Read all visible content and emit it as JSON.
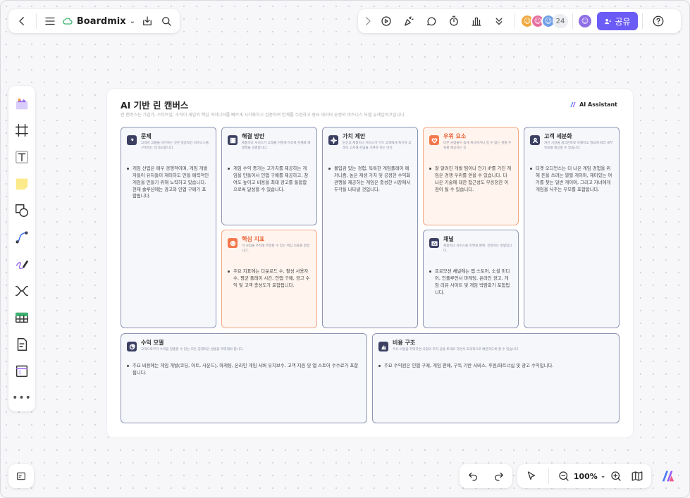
{
  "topbar": {
    "app_name": "Boardmix",
    "share_label": "공유",
    "collaborator_count": "24"
  },
  "bottombar": {
    "zoom": "100%"
  },
  "canvas": {
    "title": "AI 기반 린 캔버스",
    "subtitle": "린 캔버스는 기업가, 스타트업, 조직이 게임의 핵심 아이디어를 빠르게 시각화하고 검증하여 한계를 수정하고 중요 데이터 공생의 비즈니스 모델 유레임워크입니다.",
    "ai_assistant_label": "AI Assistant",
    "cards": {
      "problem": {
        "title": "문제",
        "desc": "고객이 고통을 야기하는 것은 정종적인 비즈니스를 구축하는 데 중요합니다.",
        "body": "게임 산업은 매우 경쟁적이며, 게임 개발자들이 유저들이 재미하도 만들 매력적인 게임을 만들기 위해 노력하고 있습니다. 현재 솔루션에는 광고와 인앱 구매가 포함됩니다."
      },
      "solution": {
        "title": "해결 방안",
        "desc": "제품이나 서비스가 고객을 어떻게 하도록 문제와 해결책을 설명합니다.",
        "body": "게임 수익 증가는 고가치를 제공하는 게임을 만들어서 인앱 구매를 제공하고, 참여도 높이고 비용을 최대 광고를 통합함으로써 달성할 수 있습니다."
      },
      "value": {
        "title": "가치 제안",
        "desc": "당신의 제품이나 서비스가 무드 고객에게 특유하 고객이 고치해 관념을 가져야 하는 이유.",
        "body": "몰입감 있는 경험, 독특한 게임플레이 메커니즘, 높은 재생 가치 및 공정한 수익화 관행을 제공하는 게임은 충성한 시장에서 두각을 나타낼 것입니다."
      },
      "advantage": {
        "title": "우위 요소",
        "desc": "다른 사람들이 쉽게 복사하거나 살 수 없는 경쟁 우위를 제공하는 것.",
        "body": "잘 알려진 개발 팀이나 인기 IP를 가진 게임은 경쟁 우위를 얻을 수 있습니다. 더 나은 기술에 대한 접근성도 부응정한 이점이 될 수 있습니다."
      },
      "segments": {
        "title": "고객 세분화",
        "desc": "자인 시장을 세그먼트로 이해하고 필요에 따라 세부 목표를 제공할 수 있습니다.",
        "body": "타겟 오디언스는 더 나은 게임 경험을 위해 돈을 쓰려는 열렬 게이머, 재미있는 여가를 찾는 일반 게이머, 그리고 자녀에게 게임을 사주는 부모를 포함합니다."
      },
      "metrics": {
        "title": "핵심 지표",
        "desc": "이 사업을 추적해 측정할 수 있는 핵심 지표를 말합니다.",
        "body": "주요 지표에는 다운로드 수, 활성 사용자 수, 평균 플레이 시간, 인앱 구매, 광고 수익 및 고객 충성도가 포함됩니다."
      },
      "channels": {
        "title": "채널",
        "desc": "제품이나 서비스를 어떻게 판매, 전달하는 방법입니다.",
        "body": "프로모션 채널에는 앱 스토어, 소셜 미디어, 인플루언서 마케팅, 온라인 광고, 게임 리뷰 사이트 및 게임 박람회가 포함됩니다."
      },
      "revenue": {
        "title": "수익 모델",
        "desc": "고객으로부터 수익을 창출할 수 있는 모든 잠재적인 방법을 파악해야 합니다.",
        "body": "주요 비용에는 게임 개발(코딩, 아트, 사운드), 마케팅, 온라인 게임 서버 유지보수, 고객 지원 및 앱 스토어 수수료가 포함됩니다."
      },
      "cost": {
        "title": "비용 구조",
        "desc": "주요 비용을 파악하면 사업의 조직 상을 토대로 하면서 효과적으로 배분하도록 할 수 있습니다.",
        "body": "주요 수익원은 인앱 구매, 게임 판매, 구독 기반 서비스, 후원/파트너십 및 광고 수익입니다."
      }
    }
  },
  "colors": {
    "accent": "#6b5cf6",
    "card_border": "#8e95b3",
    "warn_border": "#f2a785",
    "warn_title": "#e8663a"
  }
}
